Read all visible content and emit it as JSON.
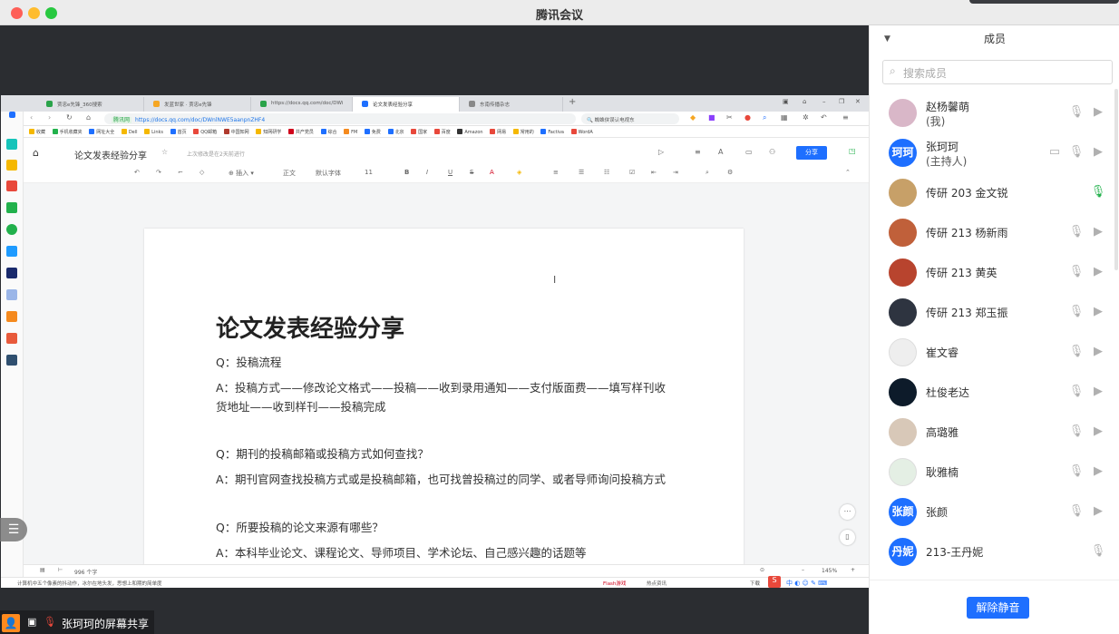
{
  "window": {
    "title": "腾讯会议"
  },
  "browser": {
    "tabs": [
      {
        "label": "贾忠e先锋_360搜索",
        "color": "#2aa34a"
      },
      {
        "label": "发蓝世家 · 贾忠e先锋",
        "color": "#f5a623"
      },
      {
        "label": "https://docs.qq.com/doc/DWi",
        "color": "#2aa34a"
      },
      {
        "label": "论文发表经验分享",
        "color": "#1e6fff"
      },
      {
        "label": "东南传播杂志",
        "color": "#888888"
      }
    ],
    "url_prefix": "腾讯网",
    "url": "https://docs.qq.com/doc/DWnlNWE5aanpnZHF4",
    "search_text": "蜘蛛侠误认电视东",
    "bookmarks": [
      "收藏",
      "手机收藏夹",
      "网址大全",
      "Dell",
      "Links",
      "首页",
      "QQ邮箱",
      "中国知网",
      "知网研学",
      "共产党员",
      "综合",
      "FM",
      "免费",
      "北京",
      "国家",
      "百度",
      "Amazon",
      "网易",
      "常用的",
      "Factiva",
      "WordA",
      "图片",
      "微信"
    ]
  },
  "doc": {
    "title": "论文发表经验分享",
    "status": "上次修改是在2天前进行",
    "share_label": "分享",
    "toolbar": {
      "insert": "插入",
      "style": "正文",
      "font": "默认字体",
      "size": "11"
    },
    "heading": "论文发表经验分享",
    "lines": [
      "Q：投稿流程",
      "A：投稿方式——修改论文格式——投稿——收到录用通知——支付版面费——填写样刊收货地址——收到样刊——投稿完成",
      "Q：期刊的投稿邮箱或投稿方式如何查找？",
      "A：期刊官网查找投稿方式或是投稿邮箱，也可找曾投稿过的同学、或者导师询问投稿方式",
      "Q：所要投稿的论文来源有哪些？",
      "A：本科毕业论文、课程论文、导师项目、学术论坛、自己感兴趣的话题等"
    ],
    "word_count": "996 个字",
    "zoom": "145%",
    "taskbar_left": "计算机中五个像素的抖动作，冰尔在地头发，思想上和期的简单度",
    "taskbar_right": [
      "Flash游戏",
      "热点资讯",
      "下载"
    ]
  },
  "share_banner": {
    "text": "张珂珂的屏幕共享"
  },
  "panel": {
    "title": "成员",
    "search_placeholder": "搜索成员",
    "unmute_label": "解除静音",
    "members": [
      {
        "name": "赵杨馨萌",
        "sub": "(我)",
        "avatar_text": "",
        "avatar_color": "#d9b7c8",
        "mic": "muted",
        "cam": "off"
      },
      {
        "name": "张珂珂",
        "sub": "(主持人)",
        "avatar_text": "珂珂",
        "avatar_color": "#1e6fff",
        "mic": "muted",
        "cam": "off",
        "screen": true
      },
      {
        "name": "传研 203 金文锐",
        "sub": "",
        "avatar_text": "",
        "avatar_color": "#c7a068",
        "mic": "on",
        "cam": "none"
      },
      {
        "name": "传研 213 杨新雨",
        "sub": "",
        "avatar_text": "",
        "avatar_color": "#c0603a",
        "mic": "muted",
        "cam": "off"
      },
      {
        "name": "传研 213 黄英",
        "sub": "",
        "avatar_text": "",
        "avatar_color": "#b8442e",
        "mic": "muted",
        "cam": "off"
      },
      {
        "name": "传研 213 郑玉振",
        "sub": "",
        "avatar_text": "",
        "avatar_color": "#2e3440",
        "mic": "muted",
        "cam": "off"
      },
      {
        "name": "崔文睿",
        "sub": "",
        "avatar_text": "",
        "avatar_color": "#eeeeee",
        "mic": "muted",
        "cam": "off"
      },
      {
        "name": "杜俊老达",
        "sub": "",
        "avatar_text": "",
        "avatar_color": "#0d1b2a",
        "mic": "muted",
        "cam": "off"
      },
      {
        "name": "高璐雅",
        "sub": "",
        "avatar_text": "",
        "avatar_color": "#d8c8b8",
        "mic": "muted",
        "cam": "off"
      },
      {
        "name": "耿雅楠",
        "sub": "",
        "avatar_text": "",
        "avatar_color": "#e4efe4",
        "mic": "muted",
        "cam": "off"
      },
      {
        "name": "张颜",
        "sub": "",
        "avatar_text": "张颜",
        "avatar_color": "#1e6fff",
        "mic": "muted",
        "cam": "off"
      },
      {
        "name": "213-王丹妮",
        "sub": "",
        "avatar_text": "丹妮",
        "avatar_color": "#1e6fff",
        "mic": "muted",
        "cam": "none"
      }
    ]
  }
}
